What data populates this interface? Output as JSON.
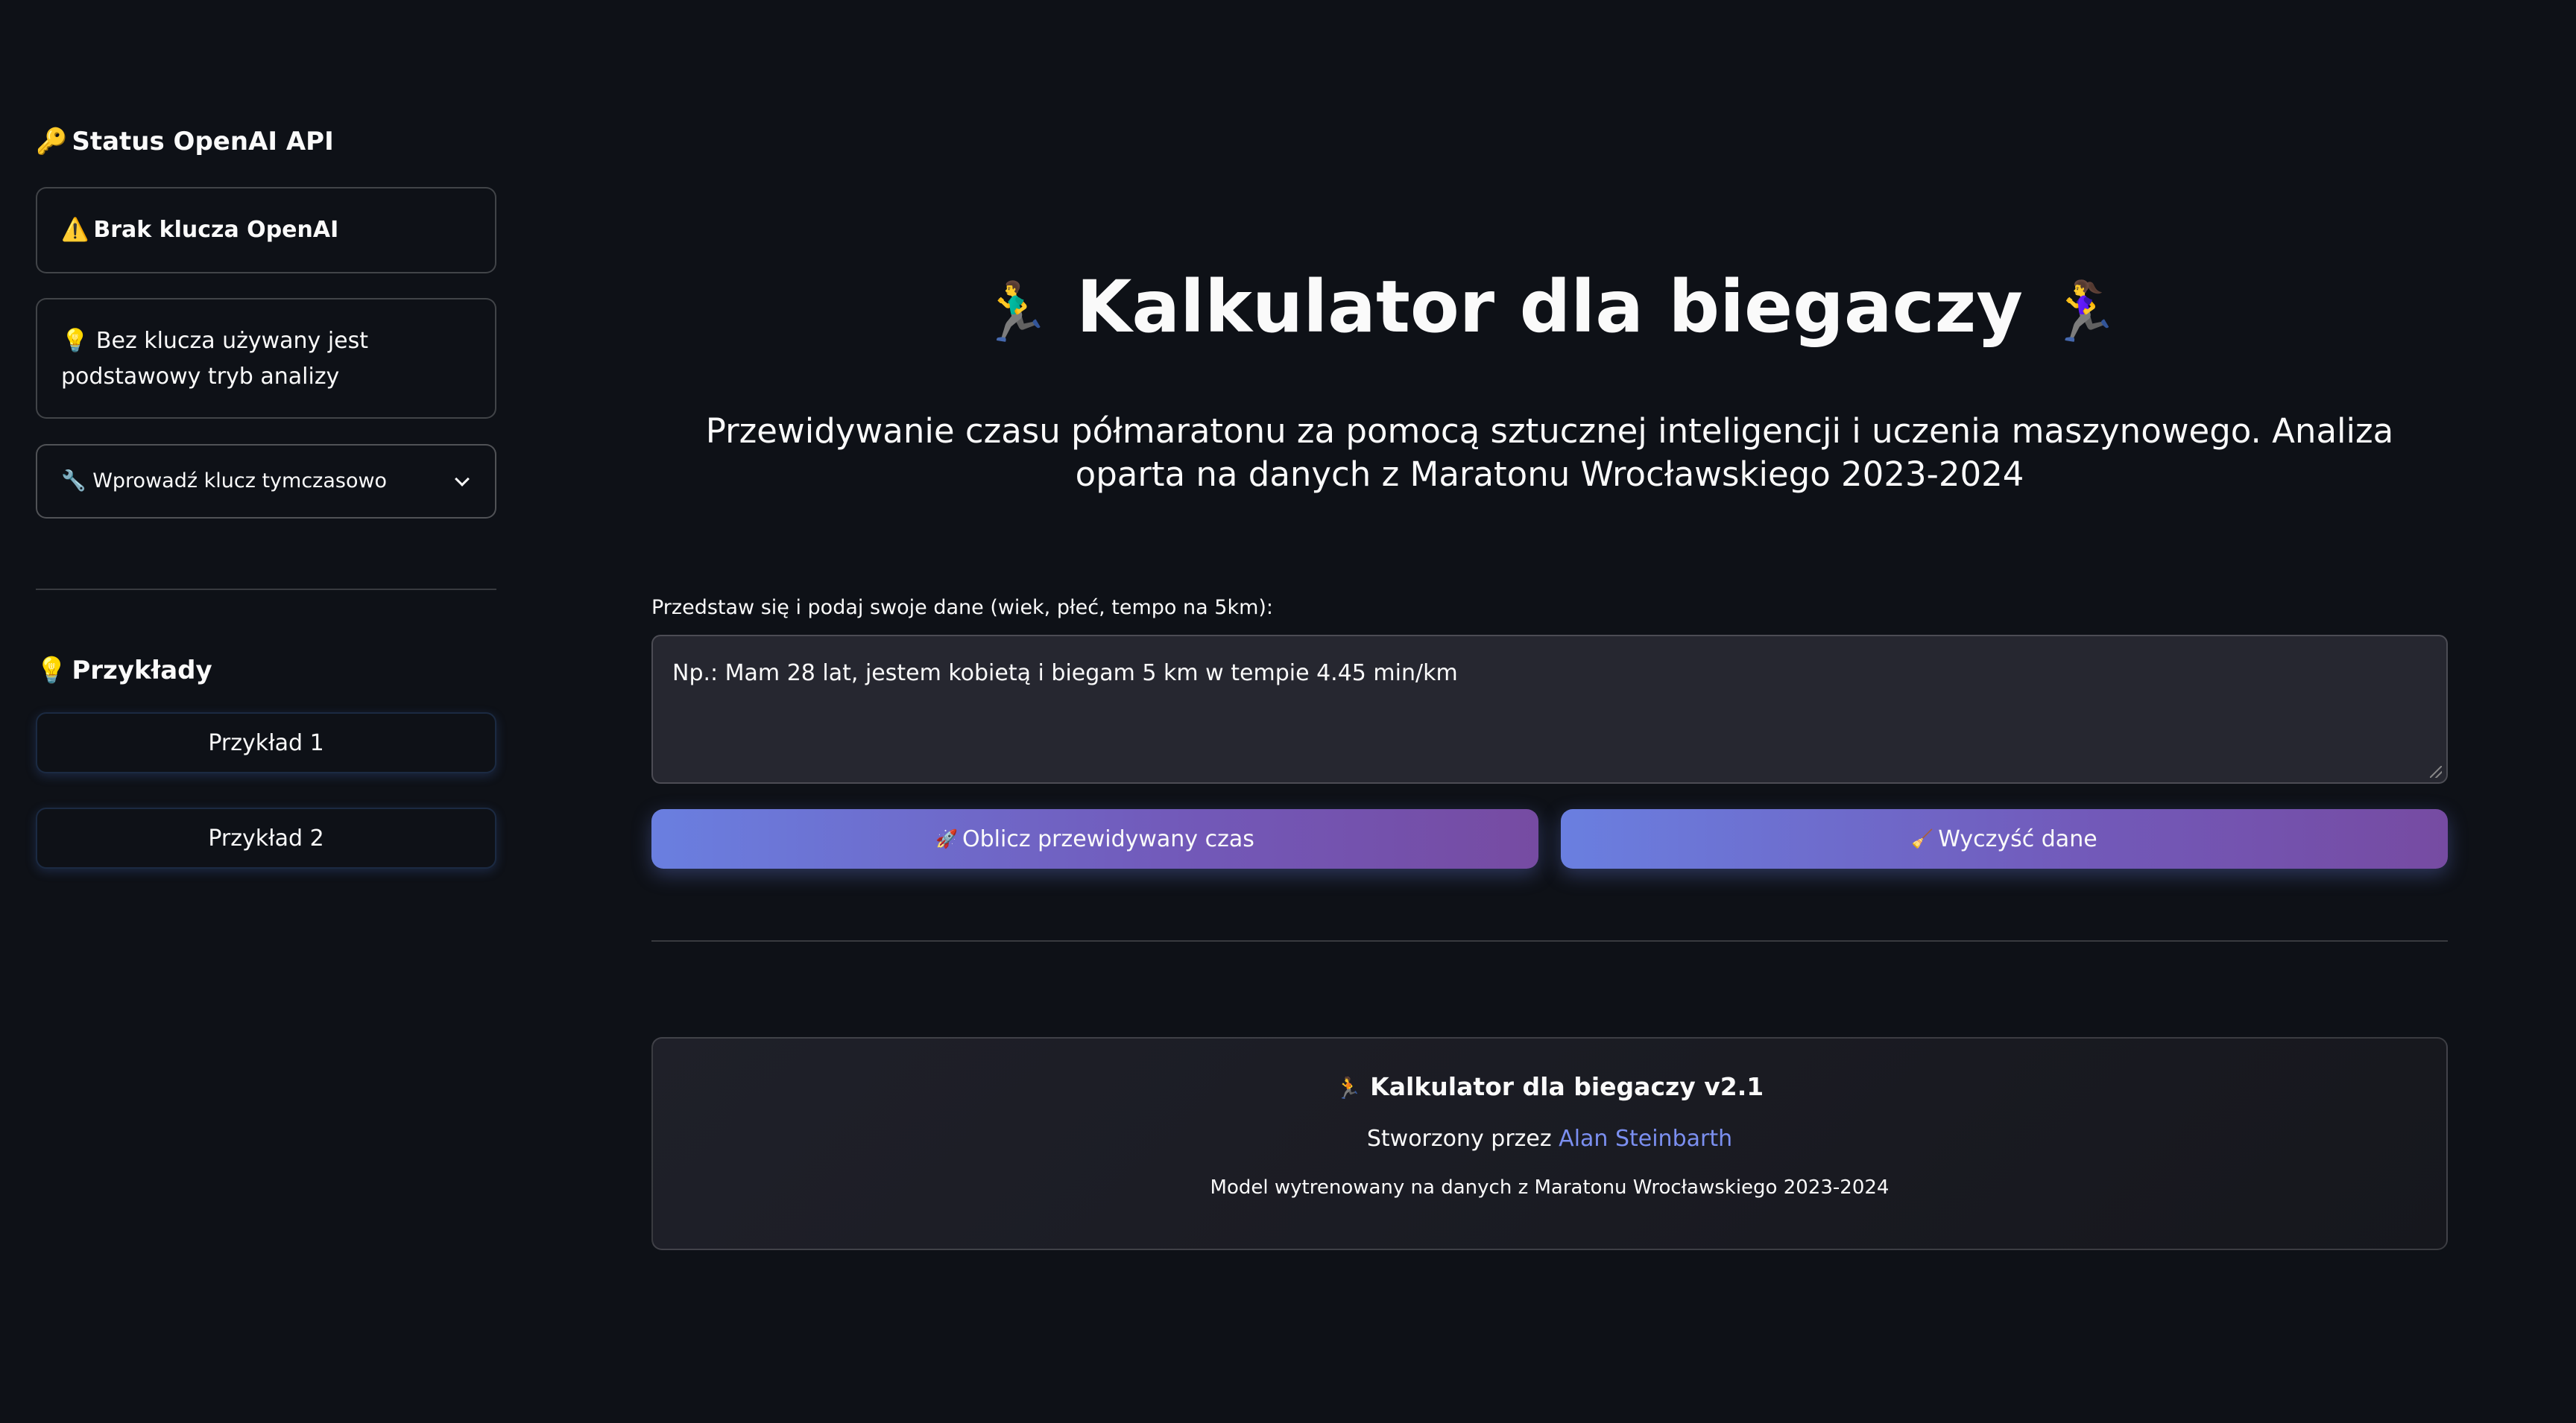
{
  "sidebar": {
    "status_header": "Status OpenAI API",
    "status_icon": "🔑",
    "warning_icon": "⚠️",
    "warning_text": "Brak klucza OpenAI",
    "info_icon": "💡",
    "info_text": "Bez klucza używany jest podstawowy tryb analizy",
    "expander_icon": "🔧",
    "expander_label": "Wprowadź klucz tymczasowo",
    "examples_icon": "💡",
    "examples_header": "Przykłady",
    "example_buttons": [
      "Przykład 1",
      "Przykład 2"
    ]
  },
  "main": {
    "title_icon_left": "🏃‍♂️",
    "title": "Kalkulator dla biegaczy",
    "title_icon_right": "🏃‍♀️",
    "subtitle": "Przewidywanie czasu półmaratonu za pomocą sztucznej inteligencji i uczenia maszynowego. Analiza oparta na danych z Maratonu Wrocławskiego 2023-2024",
    "input_label": "Przedstaw się i podaj swoje dane (wiek, płeć, tempo na 5km):",
    "input_placeholder": "Np.: Mam 28 lat, jestem kobietą i biegam 5 km w tempie 4.45 min/km",
    "calc_icon": "🚀",
    "calc_label": "Oblicz przewidywany czas",
    "clear_icon": "🧹",
    "clear_label": "Wyczyść dane"
  },
  "footer": {
    "title_icon": "🏃",
    "title": "Kalkulator dla biegaczy v2.1",
    "author_prefix": "Stworzony przez",
    "author_name": "Alan Steinbarth",
    "model_note": "Model wytrenowany na danych z Maratonu Wrocławskiego 2023-2024"
  },
  "colors": {
    "background": "#0e1117",
    "button_gradient_start": "#6a7fe0",
    "button_gradient_end": "#764ba2",
    "link": "#7b8ff0"
  }
}
